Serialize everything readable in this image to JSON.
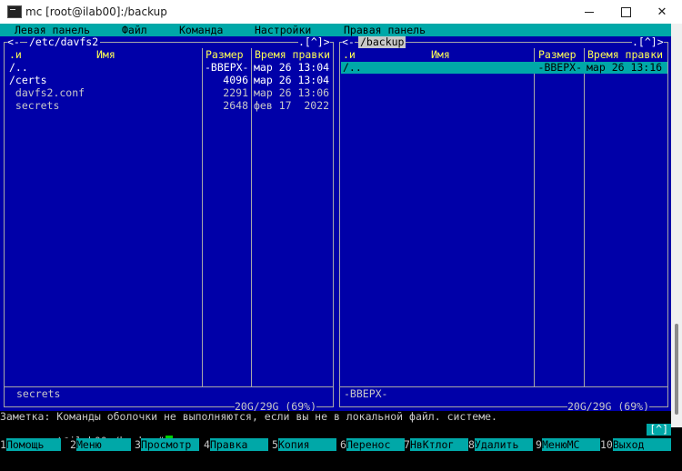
{
  "window": {
    "title": "mc [root@ilab00]:/backup"
  },
  "menubar": {
    "items": [
      "Левая панель",
      "Файл",
      "Команда",
      "Настройки",
      "Правая панель"
    ]
  },
  "left_panel": {
    "path": "/etc/davfs2",
    "corner": ".[^]>",
    "left_arrows": "<-",
    "columns": {
      "name_prefix": ".и",
      "name": "Имя",
      "size": "Размер",
      "mtime": "Время правки"
    },
    "rows": [
      {
        "name": "/..",
        "size": "-ВВЕРХ-",
        "mtime": "мар 26 13:04",
        "kind": "dir"
      },
      {
        "name": "/certs",
        "size": "4096",
        "mtime": "мар 26 13:04",
        "kind": "dir"
      },
      {
        "name": " davfs2.conf",
        "size": "2291",
        "mtime": "мар 26 13:06",
        "kind": "file"
      },
      {
        "name": " secrets",
        "size": "2648",
        "mtime": "фев 17  2022",
        "kind": "file"
      }
    ],
    "status": "secrets",
    "disk": "20G/29G (69%)"
  },
  "right_panel": {
    "path": "/backup",
    "corner": ".[^]>",
    "left_arrows": "<-",
    "columns": {
      "name_prefix": ".и",
      "name": "Имя",
      "size": "Размер",
      "mtime": "Время правки"
    },
    "rows": [
      {
        "name": "/..",
        "size": "-ВВЕРХ-",
        "mtime": "мар 26 13:16",
        "kind": "dir",
        "selected": true
      }
    ],
    "status": "-ВВЕРХ-",
    "disk": "20G/29G (69%)"
  },
  "hint": "Заметка: Команды оболочки не выполняются, если вы не в локальной файл. системе.",
  "command_line": {
    "prompt": "root@ilab00:/backup#",
    "history_button": "[^]"
  },
  "fkeys": [
    {
      "num": "1",
      "label": "Помощь"
    },
    {
      "num": "2",
      "label": "Меню"
    },
    {
      "num": "3",
      "label": "Просмотр"
    },
    {
      "num": "4",
      "label": "Правка"
    },
    {
      "num": "5",
      "label": "Копия"
    },
    {
      "num": "6",
      "label": "Перенос"
    },
    {
      "num": "7",
      "label": "НвКтлог"
    },
    {
      "num": "8",
      "label": "Удалить"
    },
    {
      "num": "9",
      "label": "МенюМС"
    },
    {
      "num": "10",
      "label": "Выход"
    }
  ],
  "colors": {
    "panel_bg": "#0000a8",
    "menubar_bg": "#00a8a8",
    "text_cyan": "#5cffff",
    "selection_bg": "#00a8a8",
    "cursor": "#00d000"
  }
}
